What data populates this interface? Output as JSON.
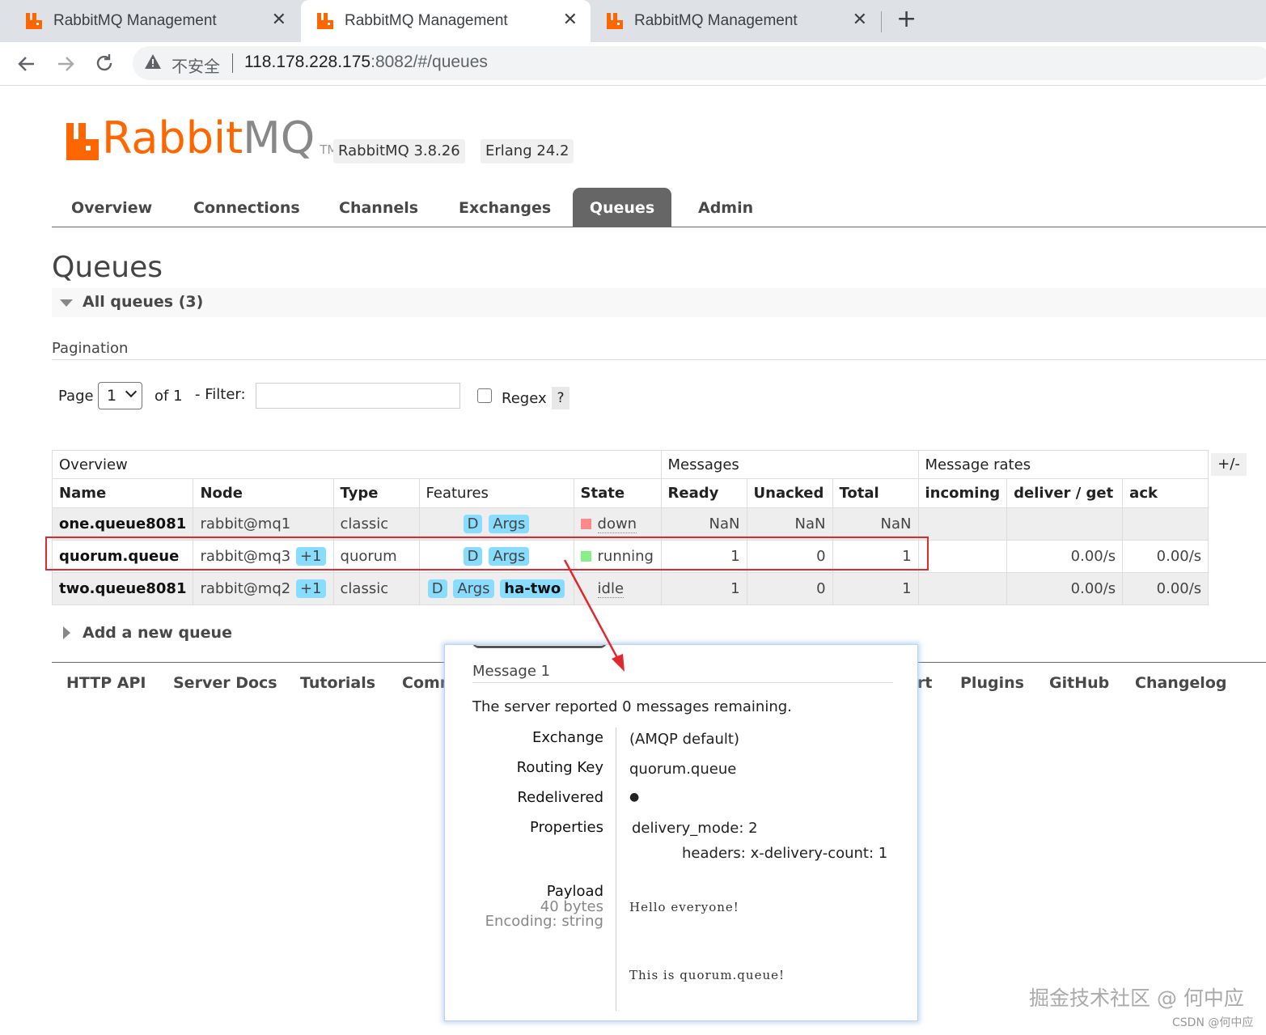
{
  "browser": {
    "tabs": [
      {
        "title": "RabbitMQ Management",
        "active": false
      },
      {
        "title": "RabbitMQ Management",
        "active": true
      },
      {
        "title": "RabbitMQ Management",
        "active": false
      }
    ],
    "close_glyph": "✕",
    "new_tab_glyph": "+",
    "insecure_label": "不安全",
    "url_host": "118.178.228.175",
    "url_rest": ":8082/#/queues",
    "icons": {
      "back": "back-arrow-icon",
      "forward": "forward-arrow-icon",
      "reload": "reload-icon",
      "warning": "warning-triangle-icon"
    }
  },
  "header": {
    "logo_rabbit": "Rabbit",
    "logo_mq": "MQ",
    "logo_tm": "TM",
    "version": "RabbitMQ 3.8.26",
    "erlang": "Erlang 24.2",
    "brand_color": "#ff6600"
  },
  "nav": {
    "items": [
      "Overview",
      "Connections",
      "Channels",
      "Exchanges",
      "Queues",
      "Admin"
    ],
    "active": "Queues"
  },
  "page": {
    "title": "Queues",
    "section": "All queues (3)"
  },
  "pagination": {
    "label": "Pagination",
    "page_label": "Page",
    "page_value": "1",
    "of_label": "of 1",
    "filter_label": "- Filter:",
    "filter_value": "",
    "regex_label": "Regex",
    "help_label": "?"
  },
  "table": {
    "groups": [
      "Overview",
      "Messages",
      "Message rates"
    ],
    "columns": [
      "Name",
      "Node",
      "Type",
      "Features",
      "State",
      "Ready",
      "Unacked",
      "Total",
      "incoming",
      "deliver / get",
      "ack"
    ],
    "toggle_label": "+/-",
    "rows": [
      {
        "name": "one.queue8081",
        "node": "rabbit@mq1",
        "node_extra": "",
        "type": "classic",
        "features": [
          "D",
          "Args"
        ],
        "state": "down",
        "ready": "NaN",
        "unacked": "NaN",
        "total": "NaN",
        "incoming": "",
        "deliver_get": "",
        "ack": ""
      },
      {
        "name": "quorum.queue",
        "node": "rabbit@mq3",
        "node_extra": "+1",
        "type": "quorum",
        "features": [
          "D",
          "Args"
        ],
        "state": "running",
        "ready": "1",
        "unacked": "0",
        "total": "1",
        "incoming": "",
        "deliver_get": "0.00/s",
        "ack": "0.00/s"
      },
      {
        "name": "two.queue8081",
        "node": "rabbit@mq2",
        "node_extra": "+1",
        "type": "classic",
        "features": [
          "D",
          "Args"
        ],
        "feature_policy": "ha-two",
        "state": "idle",
        "ready": "1",
        "unacked": "0",
        "total": "1",
        "incoming": "",
        "deliver_get": "0.00/s",
        "ack": "0.00/s"
      }
    ],
    "state_colors": {
      "down": "#f88",
      "running": "#8e8",
      "idle": "#eee"
    }
  },
  "add_queue": "Add a new queue",
  "footer": [
    "HTTP API",
    "Server Docs",
    "Tutorials",
    "Comm",
    "rt",
    "Plugins",
    "GitHub",
    "Changelog"
  ],
  "message_card": {
    "heading": "Message 1",
    "server_prefix": "The server reported ",
    "server_count": "0",
    "server_suffix": " messages remaining.",
    "labels": {
      "exchange": "Exchange",
      "routing_key": "Routing Key",
      "redelivered": "Redelivered",
      "properties": "Properties",
      "payload": "Payload",
      "payload_size": "40 bytes",
      "encoding": "Encoding: string"
    },
    "values": {
      "exchange": "(AMQP default)",
      "routing_key": "quorum.queue",
      "redelivered": "●",
      "delivery_mode_key": "delivery_mode:",
      "delivery_mode_val": "2",
      "headers_key": "headers:",
      "headers_sub_key": "x-delivery-count:",
      "headers_sub_val": "1",
      "payload_line1": "Hello everyone!",
      "payload_line2": "This is quorum.queue!"
    }
  },
  "annotation": {
    "highlight_color": "#e0282f"
  },
  "watermark": {
    "main": "掘金技术社区 @ 何中应",
    "small": "CSDN @何中应"
  }
}
